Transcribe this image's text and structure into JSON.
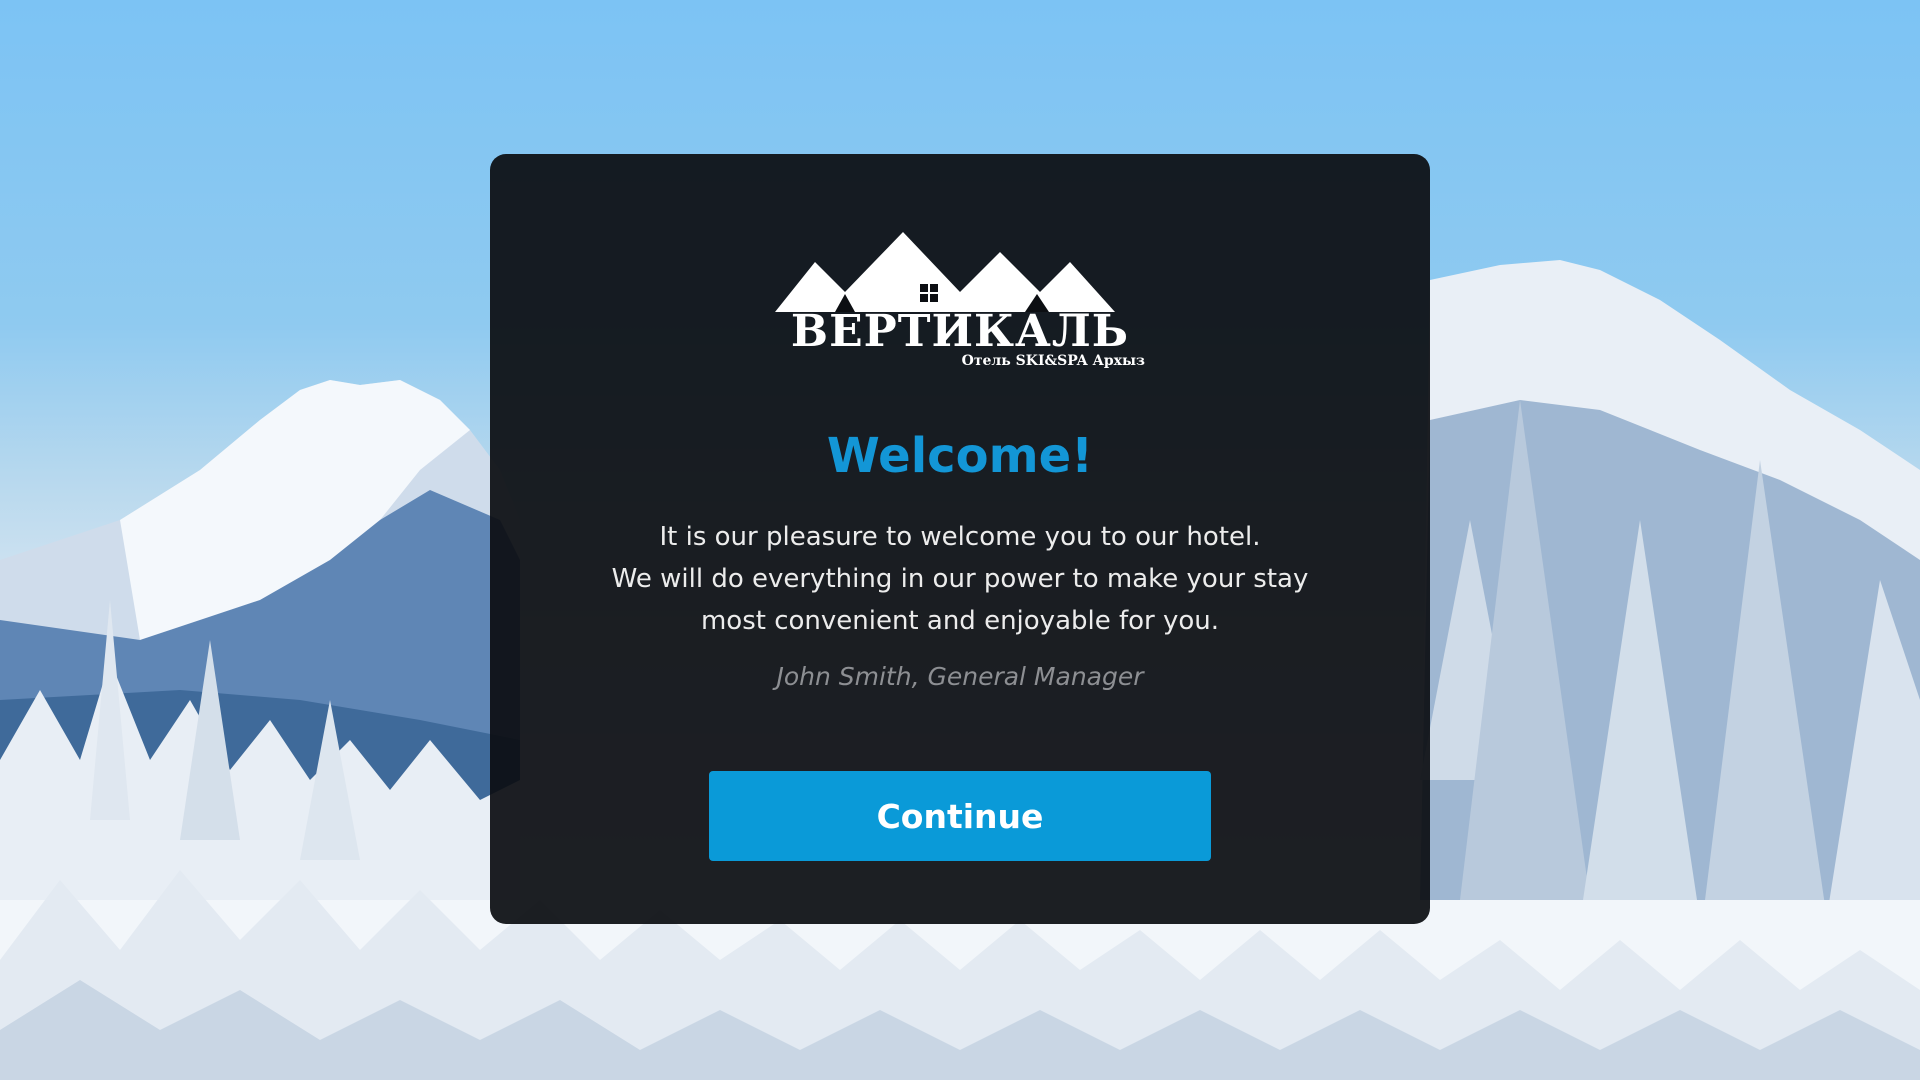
{
  "logo": {
    "icon": "mountains-logo-icon",
    "name": "ВЕРТИКАЛЬ",
    "tagline": "Отель SKI&SPA Архыз"
  },
  "welcome": {
    "title": "Welcome!",
    "message_lines": [
      "It is our pleasure to welcome you to our hotel.",
      "We will do everything in our power to make your stay",
      "most convenient and enjoyable for you."
    ],
    "signature": "John Smith, General Manager"
  },
  "actions": {
    "continue_label": "Continue"
  },
  "colors": {
    "accent": "#1396d6",
    "button": "#0a9ad8",
    "panel": "#0c0e12",
    "sky": "#7cc3f4"
  }
}
